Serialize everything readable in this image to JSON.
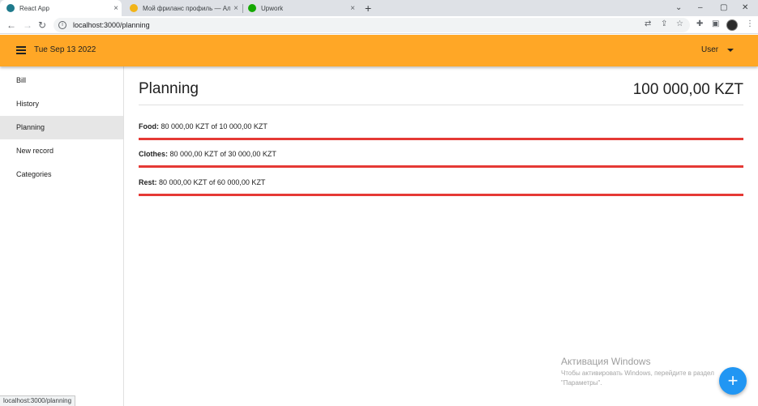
{
  "browser": {
    "tabs": [
      {
        "title": "React App",
        "close": "×",
        "favicon_color": "#1f7a8c"
      },
      {
        "title": "Мой фриланс профиль — Алдияр",
        "close": "×",
        "favicon_color": "#f2b418"
      },
      {
        "title": "Upwork",
        "close": "×",
        "favicon_color": "#14a800"
      }
    ],
    "new_tab": "+",
    "window_controls": {
      "dropdown": "⌄",
      "minimize": "–",
      "maximize": "▢",
      "close": "✕"
    },
    "nav": {
      "back": "←",
      "forward": "→",
      "reload": "↻"
    },
    "address": "localhost:3000/planning",
    "status_url": "localhost:3000/planning"
  },
  "appbar": {
    "date": "Tue Sep 13 2022",
    "user": "User",
    "color": "#ffa726"
  },
  "sidebar": {
    "items": [
      {
        "label": "Bill"
      },
      {
        "label": "History"
      },
      {
        "label": "Planning"
      },
      {
        "label": "New record"
      },
      {
        "label": "Categories"
      }
    ],
    "active_index": 2
  },
  "main": {
    "title": "Planning",
    "total": "100 000,00 KZT",
    "plans": [
      {
        "category": "Food:",
        "detail": " 80 000,00 KZT of 10 000,00 KZT",
        "progress": 1.0
      },
      {
        "category": "Clothes:",
        "detail": " 80 000,00 KZT of 30 000,00 KZT",
        "progress": 1.0
      },
      {
        "category": "Rest:",
        "detail": " 80 000,00 KZT of 60 000,00 KZT",
        "progress": 1.0
      }
    ],
    "progress_color": "#e53935"
  },
  "watermark": {
    "title": "Активация Windows",
    "line1": "Чтобы активировать Windows, перейдите в раздел",
    "line2": "\"Параметры\"."
  },
  "fab": {
    "label": "+",
    "color": "#2196f3"
  }
}
